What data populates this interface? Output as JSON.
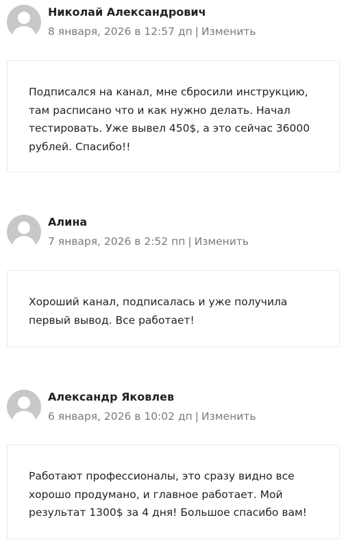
{
  "comments": [
    {
      "author": "Николай Александрович",
      "date": "8 января, 2026 в 12:57 дп",
      "separator": "|",
      "edit_label": "Изменить",
      "text": "Подписался на канал, мне сбросили инструкцию, там расписано что и как нужно делать. Начал тестировать. Уже вывел 450$, а это сейчас 36000 рублей. Спасибо!!",
      "avatar_icon": "default-user-avatar-icon"
    },
    {
      "author": "Алина",
      "date": "7 января, 2026 в 2:52 пп",
      "separator": "|",
      "edit_label": "Изменить",
      "text": "Хороший канал, подписалась и уже получила первый вывод. Все работает!",
      "avatar_icon": "default-user-avatar-icon"
    },
    {
      "author": "Александр Яковлев",
      "date": "6 января, 2026 в 10:02 дп",
      "separator": "|",
      "edit_label": "Изменить",
      "text": "Работают профессионалы, это сразу видно все хорошо продумано, и главное работает. Мой результат 1300$ за 4 дня! Большое спасибо вам!",
      "avatar_icon": "default-user-avatar-icon"
    }
  ],
  "colors": {
    "avatar_bg": "#c8c8c8",
    "meta_text": "#7a7a7a",
    "body_text": "#222222",
    "bubble_border": "#ececec"
  }
}
